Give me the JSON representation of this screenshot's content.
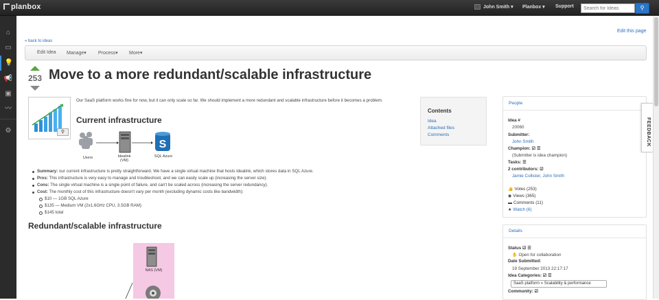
{
  "app": {
    "logo": "planbox",
    "user_menu": "John Smith",
    "planbox_menu": "Planbox",
    "support": "Support",
    "search_placeholder": "Search for Ideas"
  },
  "links": {
    "edit_page": "Edit this page",
    "back": "« back to ideas"
  },
  "toolbar": {
    "items": [
      "Edit Idea",
      "Manage",
      "Process",
      "More"
    ]
  },
  "idea": {
    "votes": "253",
    "title": "Move to a more redundant/scalable infrastructure",
    "intro": "Our SaaS platform works fine for now, but it can only scale so far. We should implement a more redundant and scalable infrastructure before it becomes a problem.",
    "h_current": "Current infrastructure",
    "h_redundant": "Redundant/scalable infrastructure",
    "diagram": {
      "users": "Users",
      "server": "Idealink (VM)",
      "sql": "SQL Azure",
      "nas": "NAS (VM)"
    },
    "bullets": [
      {
        "label": "Summary:",
        "text": " our current infrastructure is pretty straightforward. We have a single virtual machine that hosts Idealink, which stores data in SQL Azure."
      },
      {
        "label": "Pros:",
        "text": " This infrastructure is very easy to manage and troubleshoot, and we can easily scale up (increasing the server size)."
      },
      {
        "label": "Cons:",
        "text": " The single virtual machine is a single point of failure, and can't be scaled across (increasing the server redundancy)."
      },
      {
        "label": "Cost:",
        "text": " The monthly cost of this infrastructure doesn't vary per month (excluding dynamic costs like bandwidth):"
      }
    ],
    "costs": [
      "$10 — 1GB SQL Azure",
      "$135 — Medium VM (2x1.6GHz CPU, 3.5GB RAM)",
      "$145 total"
    ]
  },
  "toc": {
    "title": "Contents",
    "items": [
      "Idea",
      "Attached files",
      "Comments"
    ]
  },
  "people": {
    "heading": "People",
    "idea_no_label": "Idea #",
    "idea_no": "20060",
    "submitter_label": "Submitter:",
    "submitter": "John Smith",
    "champion_label": "Champion:",
    "champion": "(Submitter is idea champion)",
    "tasks_label": "Tasks:",
    "contributors_label": "2 contributors:",
    "contributors": "Jamie Collister, John Smith",
    "votes": "Votes (253)",
    "views": "Views (365)",
    "comments": "Comments (11)",
    "watch": "Watch (6)"
  },
  "details": {
    "heading": "Details",
    "status_label": "Status",
    "status": "Open for collaboration",
    "date_label": "Date Submitted:",
    "date": "19 September 2013 22:17:17",
    "categories_label": "Idea Categories:",
    "category": "SaaS platform » Scalability & performance",
    "community_label": "Community:"
  },
  "feedback": "FEEDBACK",
  "colors": {
    "accent": "#2a6ebb",
    "vote_up": "#5aa63e",
    "topbar": "#2b2b2b"
  }
}
